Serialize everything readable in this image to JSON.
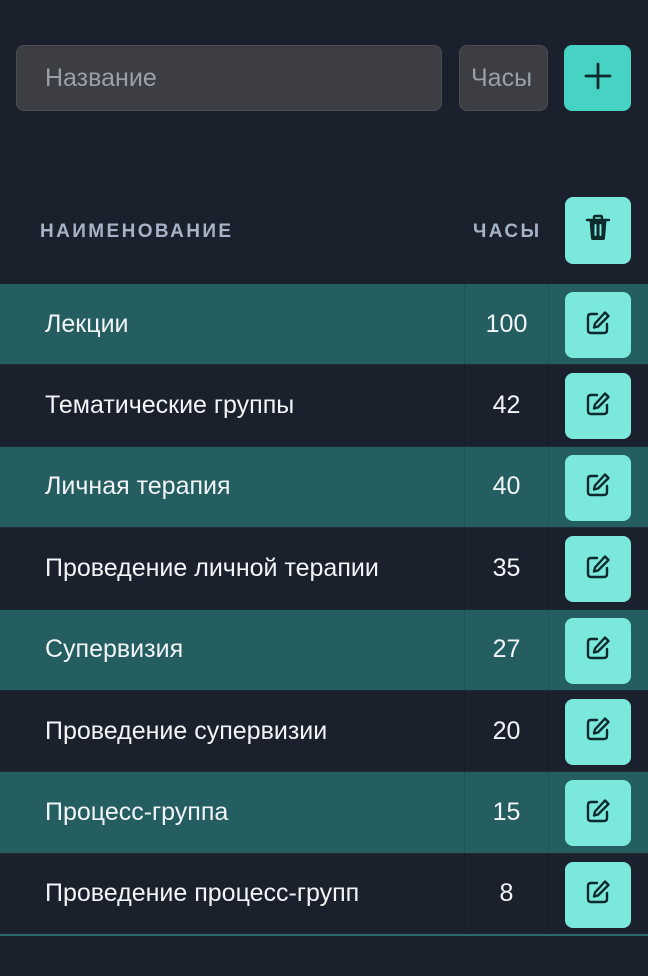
{
  "form": {
    "name_placeholder": "Название",
    "hours_placeholder": "Часы",
    "add_icon": "plus-icon"
  },
  "table": {
    "header": {
      "name": "НАИМЕНОВАНИЕ",
      "hours": "ЧАСЫ",
      "delete_icon": "trash-icon"
    },
    "rows": [
      {
        "name": "Лекции",
        "hours": "100"
      },
      {
        "name": "Тематические группы",
        "hours": "42"
      },
      {
        "name": "Личная терапия",
        "hours": "40"
      },
      {
        "name": "Проведение личной терапии",
        "hours": "35"
      },
      {
        "name": "Супервизия",
        "hours": "27"
      },
      {
        "name": "Проведение супервизии",
        "hours": "20"
      },
      {
        "name": "Процесс-группа",
        "hours": "15"
      },
      {
        "name": "Проведение процесс-групп",
        "hours": "8"
      }
    ],
    "edit_icon": "edit-icon"
  },
  "colors": {
    "background": "#1b202d",
    "row_highlight": "#245e60",
    "accent": "#47d3c4",
    "button_light": "#7be8dc",
    "header_text": "#a6b3c6"
  }
}
